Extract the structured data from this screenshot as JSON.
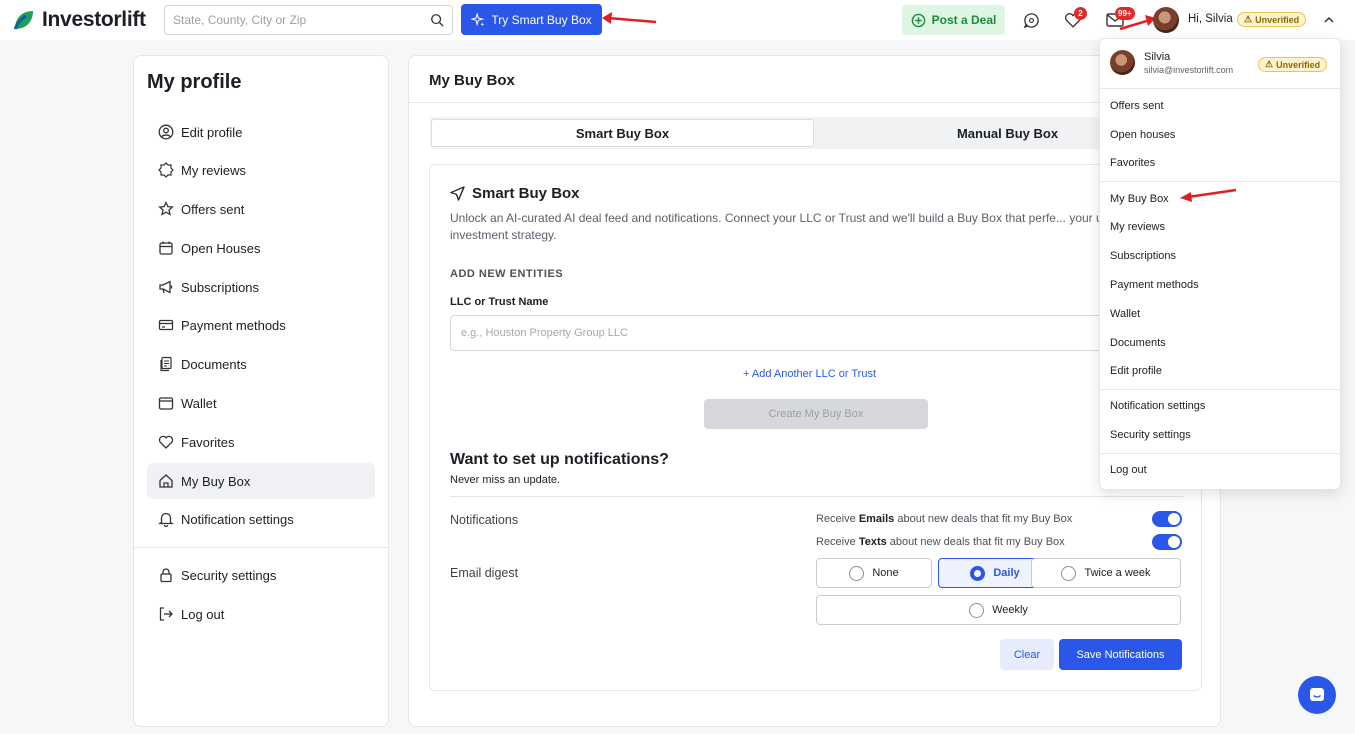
{
  "header": {
    "brand": "Investorlift",
    "search_placeholder": "State, County, City or Zip",
    "smart_buy_box_button": "Try Smart Buy Box",
    "post_deal_button": "Post a Deal",
    "favorites_badge": "2",
    "messages_badge": "99+",
    "greeting": "Hi, Silvia",
    "verification_status": "Unverified"
  },
  "sidebar": {
    "title": "My profile",
    "items": [
      {
        "label": "Edit profile",
        "icon": "user-circle-icon"
      },
      {
        "label": "My reviews",
        "icon": "badge-star-icon"
      },
      {
        "label": "Offers sent",
        "icon": "star-icon"
      },
      {
        "label": "Open Houses",
        "icon": "calendar-icon"
      },
      {
        "label": "Subscriptions",
        "icon": "megaphone-icon"
      },
      {
        "label": "Payment methods",
        "icon": "credit-card-icon"
      },
      {
        "label": "Documents",
        "icon": "documents-icon"
      },
      {
        "label": "Wallet",
        "icon": "wallet-icon"
      },
      {
        "label": "Favorites",
        "icon": "heart-icon"
      },
      {
        "label": "My Buy Box",
        "icon": "home-icon",
        "active": true
      },
      {
        "label": "Notification settings",
        "icon": "bell-icon"
      }
    ],
    "bottom_items": [
      {
        "label": "Security settings",
        "icon": "lock-icon"
      },
      {
        "label": "Log out",
        "icon": "logout-icon"
      }
    ]
  },
  "main": {
    "title": "My Buy Box",
    "tabs": [
      {
        "label": "Smart Buy Box",
        "active": true
      },
      {
        "label": "Manual Buy Box",
        "active": false
      }
    ],
    "smart": {
      "title": "Smart Buy Box",
      "description": "Unlock an AI-curated AI deal feed and notifications. Connect your LLC or Trust and we'll build a Buy Box that perfe... your unique investment strategy.",
      "section_label": "ADD NEW ENTITIES",
      "field_label": "LLC or Trust Name",
      "field_placeholder": "e.g., Houston Property Group LLC",
      "add_link": "+ Add Another LLC or Trust",
      "create_button": "Create My Buy Box"
    },
    "notifications": {
      "title": "Want to set up notifications?",
      "subtitle": "Never miss an update.",
      "notifications_label": "Notifications",
      "email_toggle_prefix": "Receive",
      "email_toggle_bold": "Emails",
      "email_toggle_suffix": "about new deals that fit my Buy Box",
      "text_toggle_prefix": "Receive",
      "text_toggle_bold": "Texts",
      "text_toggle_suffix": "about new deals that fit my Buy Box",
      "email_enabled": true,
      "texts_enabled": true,
      "digest_label": "Email digest",
      "digest_options": [
        "None",
        "Daily",
        "Twice a week",
        "Weekly"
      ],
      "digest_selected": "Daily",
      "clear_button": "Clear",
      "save_button": "Save Notifications"
    }
  },
  "dropdown": {
    "name": "Silvia",
    "email": "silvia@investorlift.com",
    "status": "Unverified",
    "group1": [
      "Offers sent",
      "Open houses",
      "Favorites"
    ],
    "group2": [
      "My Buy Box",
      "My reviews",
      "Subscriptions",
      "Payment methods",
      "Wallet",
      "Documents",
      "Edit profile"
    ],
    "group3": [
      "Notification settings",
      "Security settings"
    ],
    "group4": [
      "Log out"
    ]
  },
  "colors": {
    "primary": "#2a57e8",
    "success": "#1d8a3a",
    "badge": "#e02b2b",
    "annotation_arrow": "#e02020"
  }
}
